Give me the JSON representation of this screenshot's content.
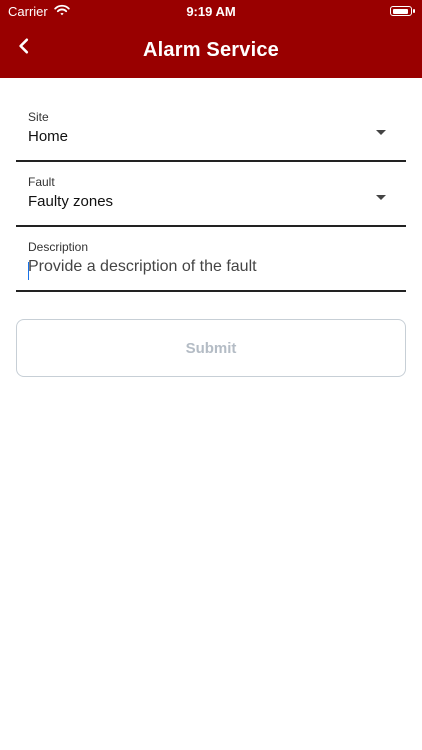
{
  "status_bar": {
    "carrier": "Carrier",
    "time": "9:19 AM",
    "wifi_icon": "wifi-icon",
    "battery_icon": "battery-icon"
  },
  "header": {
    "title": "Alarm Service",
    "back_icon": "chevron-left-icon",
    "background_color": "#990000"
  },
  "form": {
    "site": {
      "label": "Site",
      "value": "Home",
      "dropdown_icon": "caret-down-icon"
    },
    "fault": {
      "label": "Fault",
      "value": "Faulty zones",
      "dropdown_icon": "caret-down-icon"
    },
    "description": {
      "label": "Description",
      "placeholder": "Provide a description of the fault",
      "value": ""
    },
    "submit": {
      "label": "Submit",
      "state": "disabled"
    }
  }
}
